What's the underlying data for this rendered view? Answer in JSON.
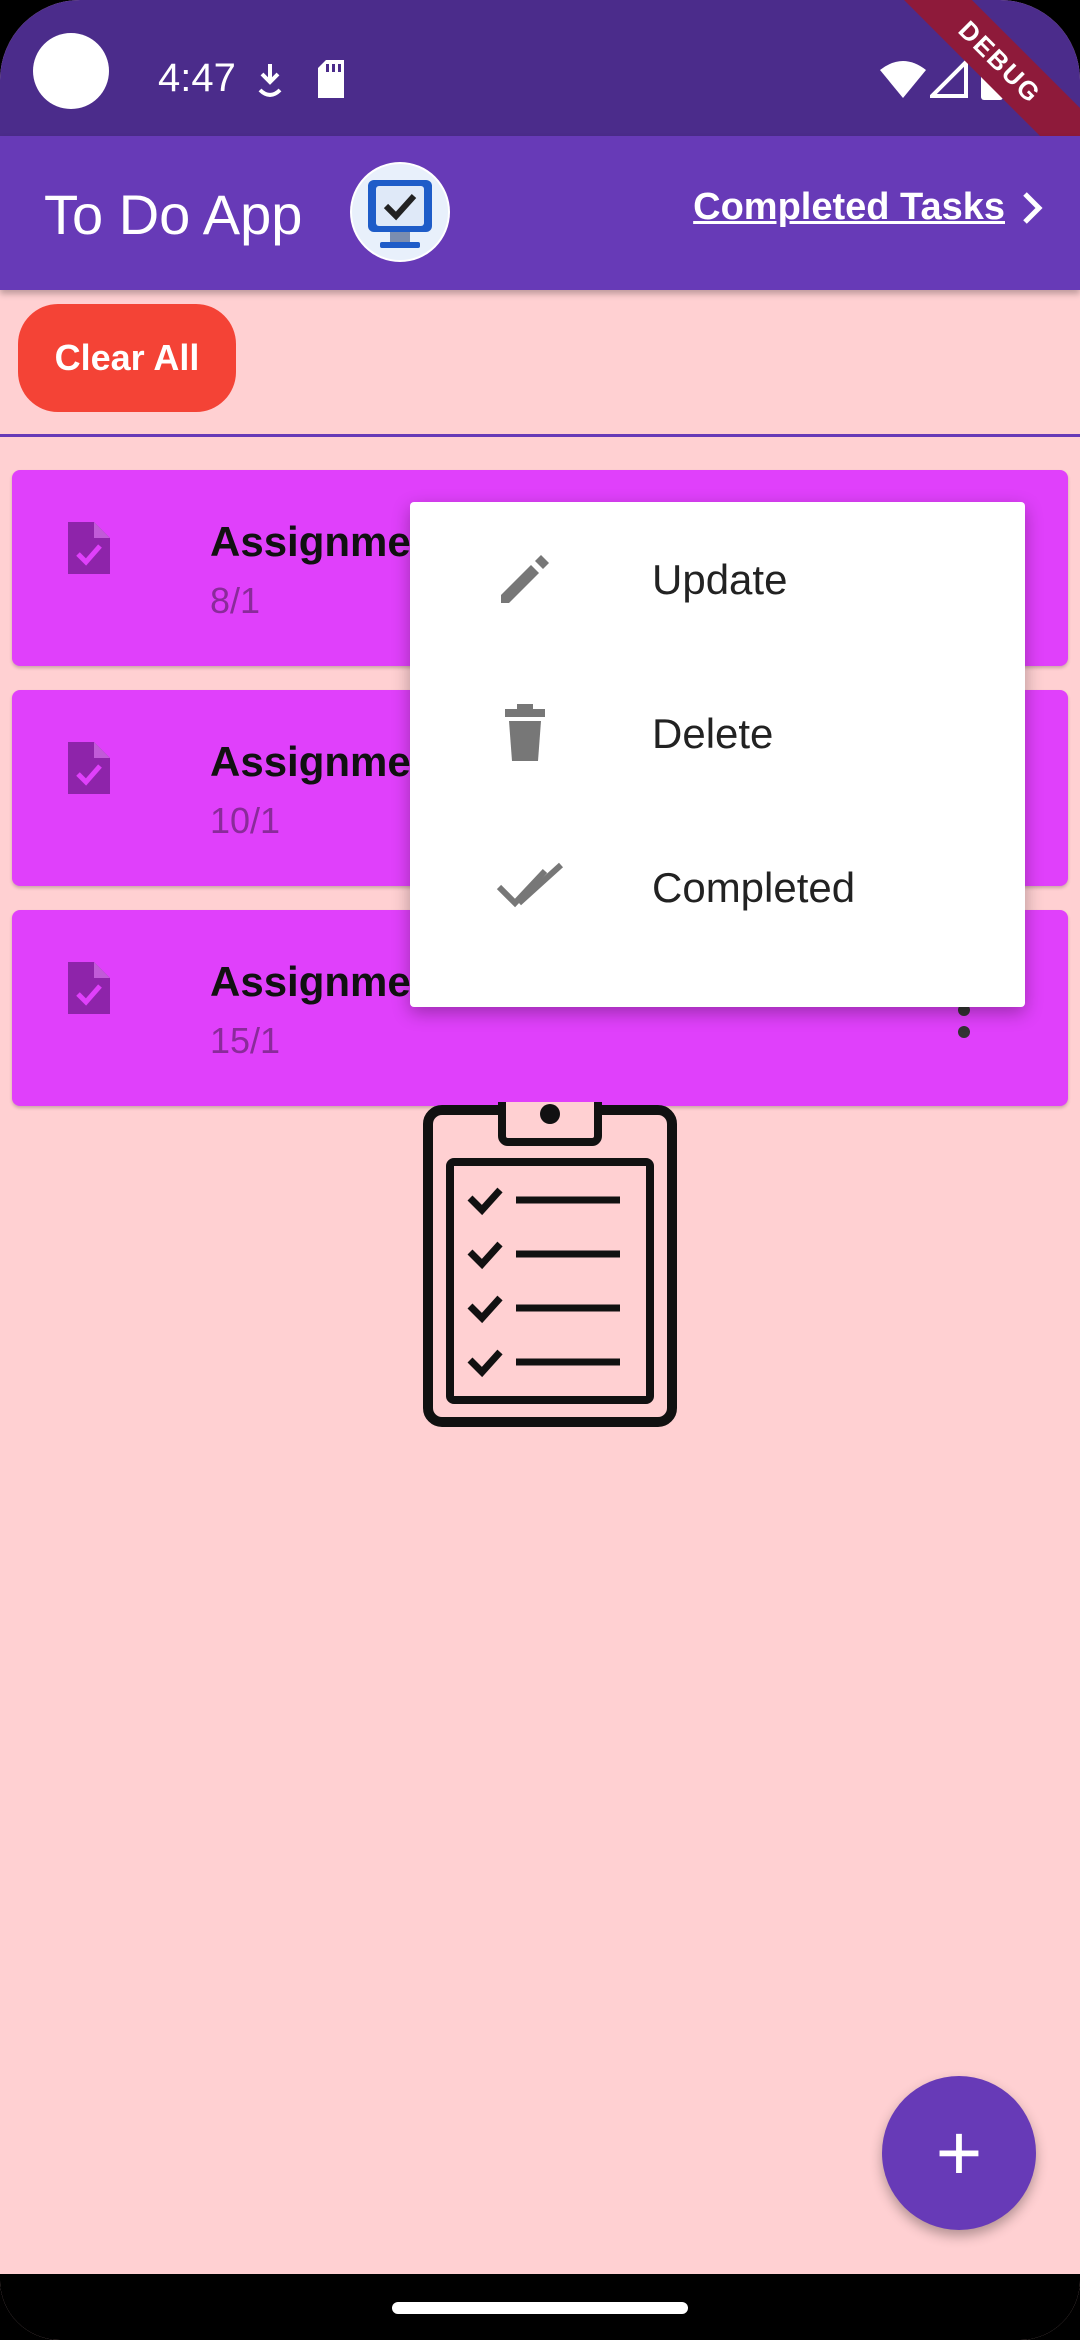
{
  "status_bar": {
    "time": "4:47",
    "icons": [
      "download-icon",
      "sd-card-icon",
      "wifi-icon",
      "signal-icon",
      "battery-icon"
    ],
    "debug_banner": "DEBUG"
  },
  "app_bar": {
    "title": "To Do App",
    "logo_icon": "checklist-monitor-icon",
    "completed_link": "Completed Tasks"
  },
  "actions": {
    "clear_all": "Clear All"
  },
  "tasks": [
    {
      "title": "Assignme",
      "date": "8/1"
    },
    {
      "title": "Assignme",
      "date": "10/1"
    },
    {
      "title": "Assignme",
      "date": "15/1"
    }
  ],
  "popup_menu": {
    "items": [
      {
        "label": "Update",
        "icon": "pencil-icon"
      },
      {
        "label": "Delete",
        "icon": "trash-icon"
      },
      {
        "label": "Completed",
        "icon": "double-check-icon"
      }
    ]
  },
  "fab": {
    "label": "+"
  },
  "colors": {
    "status_bar": "#4b2c8b",
    "app_bar": "#673ab7",
    "background": "#ffd0d2",
    "card": "#e040fb",
    "clear_button": "#f44336",
    "fab": "#673ab7"
  }
}
